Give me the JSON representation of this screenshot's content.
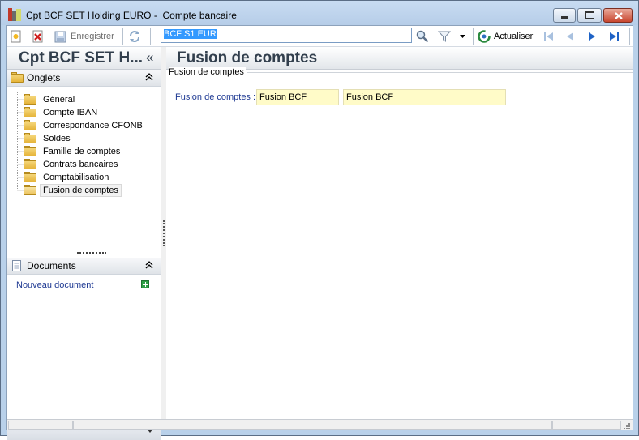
{
  "window": {
    "title": "Cpt BCF SET Holding EURO -  Compte bancaire"
  },
  "toolbar": {
    "save_label": "Enregistrer",
    "search_value": "BCF S1 EUR",
    "refresh_label": "Actualiser"
  },
  "left_panel": {
    "title": "Cpt BCF SET H...",
    "collapse_glyph": "«",
    "tabs_header": "Onglets",
    "tabs": [
      {
        "label": "Général"
      },
      {
        "label": "Compte IBAN"
      },
      {
        "label": "Correspondance CFONB"
      },
      {
        "label": "Soldes"
      },
      {
        "label": "Famille de comptes"
      },
      {
        "label": "Contrats bancaires"
      },
      {
        "label": "Comptabilisation"
      },
      {
        "label": "Fusion de comptes",
        "selected": true
      }
    ],
    "documents_header": "Documents",
    "new_document_label": "Nouveau document"
  },
  "main": {
    "title": "Fusion de comptes",
    "group_label": "Fusion de comptes",
    "field_label": "Fusion de comptes :",
    "field_code": "Fusion BCF",
    "field_name": "Fusion BCF"
  },
  "colors": {
    "accent": "#1f3a93",
    "field_background": "#fffbc8",
    "selection": "#3399ff"
  }
}
